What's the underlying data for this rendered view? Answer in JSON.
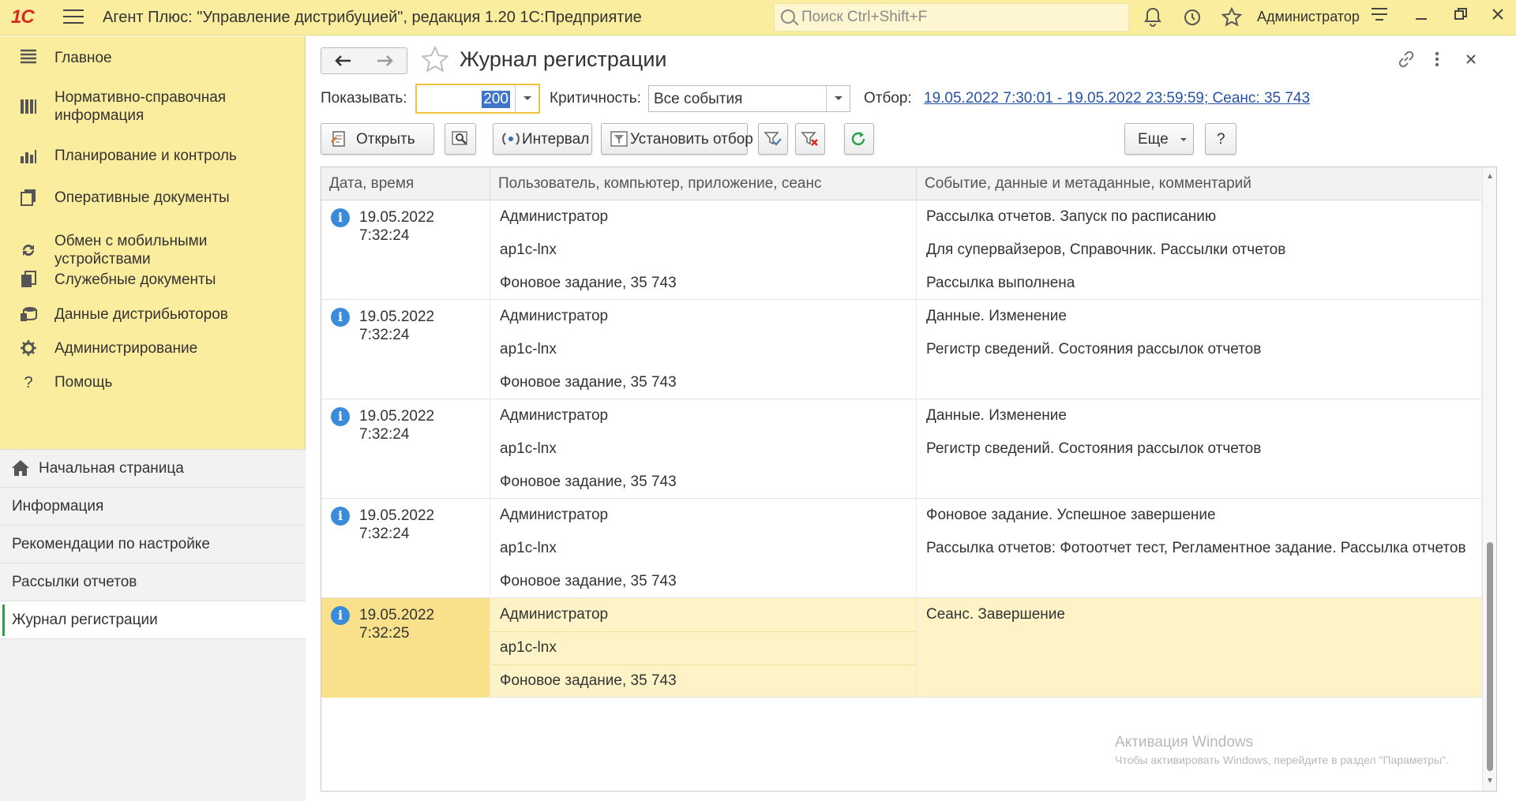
{
  "titlebar": {
    "logo": "1С",
    "title": "Агент Плюс: \"Управление дистрибуцией\", редакция 1.20 1С:Предприятие",
    "search_placeholder": "Поиск Ctrl+Shift+F",
    "user": "Администратор"
  },
  "sidebar": {
    "sections": [
      {
        "label": "Главное",
        "icon": "menu-list-icon"
      },
      {
        "label": "Нормативно-справочная информация",
        "icon": "reference-icon"
      },
      {
        "label": "Планирование и контроль",
        "icon": "chart-icon"
      },
      {
        "label": "Оперативные документы",
        "icon": "documents-icon"
      },
      {
        "label": "Обмен с мобильными устройствами",
        "icon": "sync-icon"
      },
      {
        "label": "Служебные документы",
        "icon": "service-docs-icon"
      },
      {
        "label": "Данные дистрибьюторов",
        "icon": "distributor-data-icon"
      },
      {
        "label": "Администрирование",
        "icon": "gear-icon"
      },
      {
        "label": "Помощь",
        "icon": "help-icon"
      }
    ],
    "open_windows": [
      {
        "label": "Начальная страница"
      },
      {
        "label": "Информация"
      },
      {
        "label": "Рекомендации по настройке"
      },
      {
        "label": "Рассылки отчетов"
      },
      {
        "label": "Журнал регистрации"
      }
    ]
  },
  "form": {
    "title": "Журнал регистрации",
    "show_label": "Показывать:",
    "show_value": "200",
    "criticality_label": "Критичность:",
    "criticality_value": "Все события",
    "filter_label": "Отбор:",
    "filter_value": "19.05.2022 7:30:01 - 19.05.2022 23:59:59; Сеанс: 35 743",
    "buttons": {
      "open": "Открыть",
      "interval": "Интервал",
      "set_filter": "Установить отбор",
      "more": "Еще",
      "help": "?"
    }
  },
  "table": {
    "columns": [
      "Дата, время",
      "Пользователь, компьютер, приложение, сеанс",
      "Событие, данные и метаданные, комментарий"
    ],
    "rows": [
      {
        "date": "19.05.2022",
        "time": "7:32:24",
        "user": "Администратор",
        "computer": "ap1c-lnx",
        "session": "Фоновое задание, 35 743",
        "event": "Рассылка отчетов. Запуск по расписанию",
        "data": "Для супервайзеров, Справочник. Рассылки отчетов",
        "comment": "Рассылка выполнена"
      },
      {
        "date": "19.05.2022",
        "time": "7:32:24",
        "user": "Администратор",
        "computer": "ap1c-lnx",
        "session": "Фоновое задание, 35 743",
        "event": "Данные. Изменение",
        "data": "Регистр сведений. Состояния рассылок отчетов",
        "comment": ""
      },
      {
        "date": "19.05.2022",
        "time": "7:32:24",
        "user": "Администратор",
        "computer": "ap1c-lnx",
        "session": "Фоновое задание, 35 743",
        "event": "Данные. Изменение",
        "data": "Регистр сведений. Состояния рассылок отчетов",
        "comment": ""
      },
      {
        "date": "19.05.2022",
        "time": "7:32:24",
        "user": "Администратор",
        "computer": "ap1c-lnx",
        "session": "Фоновое задание, 35 743",
        "event": "Фоновое задание. Успешное завершение",
        "data": "Рассылка отчетов: Фотоотчет тест, Регламентное задание. Рассылка отчетов",
        "comment": ""
      },
      {
        "date": "19.05.2022",
        "time": "7:32:25",
        "user": "Администратор",
        "computer": "ap1c-lnx",
        "session": "Фоновое задание, 35 743",
        "event": "Сеанс. Завершение",
        "data": "",
        "comment": ""
      }
    ]
  },
  "watermark": {
    "line1": "Активация Windows",
    "line2": "Чтобы активировать Windows, перейдите в раздел \"Параметры\"."
  }
}
